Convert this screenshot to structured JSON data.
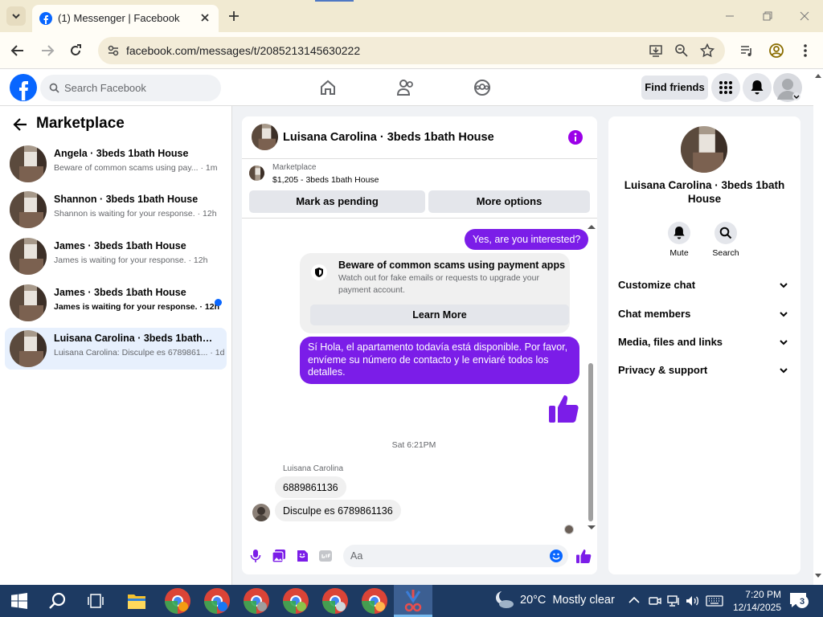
{
  "browser": {
    "tab_title": "(1) Messenger | Facebook",
    "url": "facebook.com/messages/t/2085213145630222"
  },
  "fb": {
    "search_placeholder": "Search Facebook",
    "find_friends": "Find friends"
  },
  "marketplace": {
    "title": "Marketplace",
    "conversations": [
      {
        "name": "Angela · 3beds 1bath House",
        "snippet": "Beware of common scams using pay...",
        "time": "· 1m",
        "unread": false,
        "selected": false
      },
      {
        "name": "Shannon · 3beds 1bath House",
        "snippet": "Shannon is waiting for your response.",
        "time": "· 12h",
        "unread": false,
        "selected": false
      },
      {
        "name": "James · 3beds 1bath House",
        "snippet": "James is waiting for your response.",
        "time": "· 12h",
        "unread": false,
        "selected": false
      },
      {
        "name": "James · 3beds 1bath House",
        "snippet": "James is waiting for your response.",
        "time": "· 12h",
        "unread": true,
        "selected": false
      },
      {
        "name": "Luisana Carolina · 3beds 1bath Ho...",
        "snippet": "Luisana Carolina: Disculpe es 6789861...",
        "time": "· 1d",
        "unread": false,
        "selected": true
      }
    ]
  },
  "chat": {
    "header_name": "Luisana Carolina · 3beds 1bath House",
    "listing_source": "Marketplace",
    "listing_price": "$1,205 - 3beds 1bath House",
    "mark_pending": "Mark as pending",
    "more_options": "More options",
    "msg_out_1": "Yes, are you interested?",
    "scam_title": "Beware of common scams using payment apps",
    "scam_line_1": "Watch out for fake emails or requests to upgrade your",
    "scam_line_2": "payment account.",
    "learn_more": "Learn More",
    "msg_out_2_lines": [
      "Sí Hola, el apartamento todavía está disponible. Por favor,",
      "envíeme su número de contacto y le enviaré todos los",
      "detalles."
    ],
    "timestamp": "Sat 6:21PM",
    "sender": "Luisana Carolina",
    "msg_in_1": "6889861136",
    "msg_in_2": "Disculpe es 6789861136",
    "composer_placeholder": "Aa"
  },
  "right_panel": {
    "name_line_1": "Luisana Carolina · 3beds 1bath",
    "name_line_2": "House",
    "mute_label": "Mute",
    "search_label": "Search",
    "sections": [
      "Customize chat",
      "Chat members",
      "Media, files and links",
      "Privacy & support"
    ]
  },
  "taskbar": {
    "weather": "20°C  Mostly clear",
    "time": "7:20 PM",
    "date": "12/14/2025",
    "notification_count": "3"
  },
  "colors": {
    "fb_blue": "#0866ff",
    "messenger_purple": "#7b1de8",
    "taskbar": "#1d3a62"
  }
}
